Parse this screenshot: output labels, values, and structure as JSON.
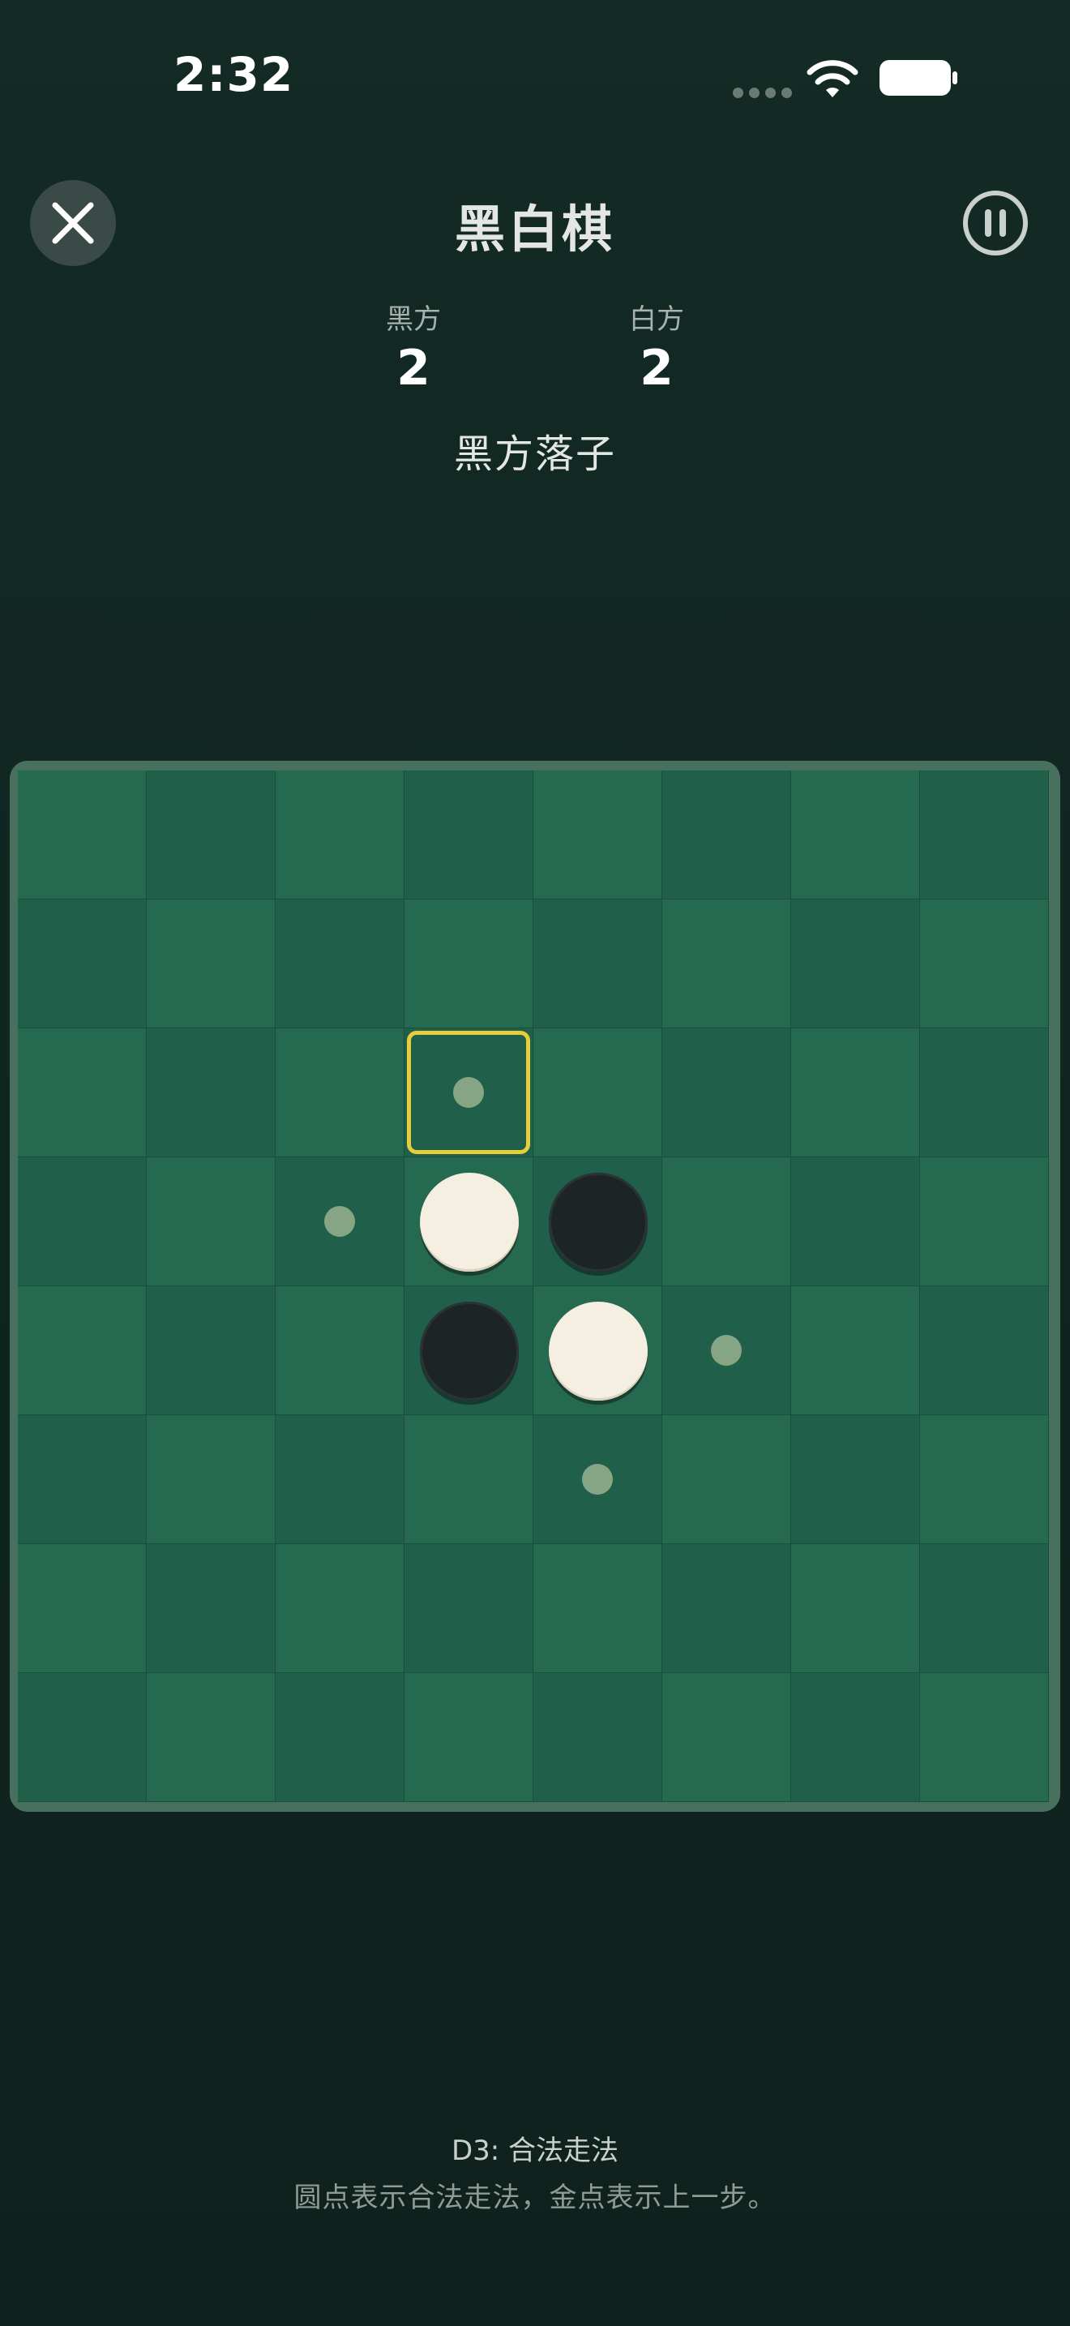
{
  "status_bar": {
    "time": "2:32"
  },
  "header": {
    "title": "黑白棋",
    "close_icon": "close-icon",
    "pause_icon": "pause-icon"
  },
  "scores": {
    "black": {
      "label": "黑方",
      "value": "2"
    },
    "white": {
      "label": "白方",
      "value": "2"
    }
  },
  "turn": "黑方落子",
  "board": {
    "rows": [
      [
        "",
        "",
        "",
        "",
        "",
        "",
        "",
        ""
      ],
      [
        "",
        "",
        "",
        "",
        "",
        "",
        "",
        ""
      ],
      [
        "",
        "",
        "",
        "hint-last",
        "",
        "",
        "",
        ""
      ],
      [
        "",
        "",
        "hint",
        "white",
        "black",
        "",
        "",
        ""
      ],
      [
        "",
        "",
        "",
        "black",
        "white",
        "hint",
        "",
        ""
      ],
      [
        "",
        "",
        "",
        "",
        "hint",
        "",
        "",
        ""
      ],
      [
        "",
        "",
        "",
        "",
        "",
        "",
        "",
        ""
      ],
      [
        "",
        "",
        "",
        "",
        "",
        "",
        "",
        ""
      ]
    ],
    "colors": {
      "light_cell": "#256a50",
      "dark_cell": "#20604a",
      "hint_dot": "#86a585",
      "highlight": "#e8cf3a",
      "white_piece": "#f5efe1",
      "black_piece": "#1c2426"
    }
  },
  "footer": {
    "status": "D3: 合法走法",
    "hint": "圆点表示合法走法，金点表示上一步。"
  }
}
